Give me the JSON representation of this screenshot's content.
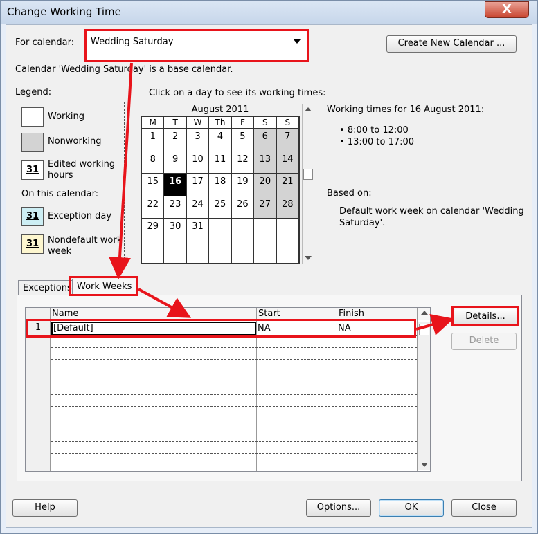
{
  "window": {
    "title": "Change Working Time",
    "close_glyph": "X"
  },
  "calendar_select": {
    "label": "For calendar:",
    "value": "Wedding Saturday"
  },
  "create_calendar_button": "Create New Calendar ...",
  "base_note": "Calendar 'Wedding Saturday' is a base calendar.",
  "legend": {
    "title": "Legend:",
    "working": "Working",
    "nonworking": "Nonworking",
    "edited_line1": "Edited working",
    "edited_line2": "hours",
    "on_this_calendar": "On this calendar:",
    "exception": "Exception day",
    "nondefault_line1": "Nondefault work",
    "nondefault_line2": "week",
    "swatch_num": "31"
  },
  "calendar": {
    "instruction": "Click on a day to see its working times:",
    "month": "August 2011",
    "days": [
      "M",
      "T",
      "W",
      "Th",
      "F",
      "S",
      "S"
    ],
    "weeks": [
      [
        "1",
        "2",
        "3",
        "4",
        "5",
        "6",
        "7"
      ],
      [
        "8",
        "9",
        "10",
        "11",
        "12",
        "13",
        "14"
      ],
      [
        "15",
        "16",
        "17",
        "18",
        "19",
        "20",
        "21"
      ],
      [
        "22",
        "23",
        "24",
        "25",
        "26",
        "27",
        "28"
      ],
      [
        "29",
        "30",
        "31",
        "",
        "",
        "",
        ""
      ],
      [
        "",
        "",
        "",
        "",
        "",
        "",
        ""
      ]
    ],
    "selected": "16"
  },
  "working_times": {
    "heading": "Working times for 16 August 2011:",
    "times": [
      "8:00 to 12:00",
      "13:00 to 17:00"
    ],
    "based_on_label": "Based on:",
    "based_on_line1": "Default work week on calendar 'Wedding",
    "based_on_line2": "Saturday'."
  },
  "tabs": {
    "exceptions": "Exceptions",
    "work_weeks": "Work Weeks"
  },
  "grid": {
    "columns": [
      "Name",
      "Start",
      "Finish"
    ],
    "rows": [
      {
        "num": "1",
        "name": "[Default]",
        "start": "NA",
        "finish": "NA"
      }
    ]
  },
  "side_buttons": {
    "details": "Details...",
    "delete": "Delete"
  },
  "footer": {
    "help": "Help",
    "options": "Options...",
    "ok": "OK",
    "close": "Close"
  },
  "colors": {
    "annotation_red": "#e8141b",
    "nonworking_gray": "#d3d3d3"
  }
}
